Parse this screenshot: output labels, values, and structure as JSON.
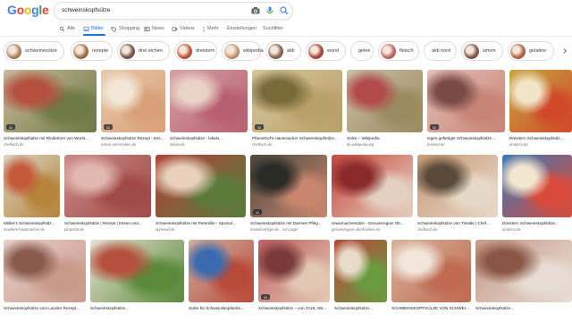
{
  "logo": {
    "letters": [
      "G",
      "o",
      "o",
      "g",
      "l",
      "e"
    ],
    "colors": [
      "#4285F4",
      "#EA4335",
      "#FBBC05",
      "#4285F4",
      "#34A853",
      "#EA4335"
    ]
  },
  "search": {
    "query": "schweinskopfsülze",
    "icons": [
      "camera-icon",
      "mic-icon",
      "search-icon"
    ]
  },
  "tabs": [
    {
      "label": "Alle",
      "icon": "search-icon"
    },
    {
      "label": "Bilder",
      "icon": "image-icon",
      "active": true
    },
    {
      "label": "Shopping",
      "icon": "tag-icon"
    },
    {
      "label": "News",
      "icon": "news-icon"
    },
    {
      "label": "Videos",
      "icon": "video-icon"
    },
    {
      "label": "Mehr",
      "icon": "more-icon"
    },
    {
      "label": "Einstellungen"
    },
    {
      "label": "Suchfilter"
    }
  ],
  "chips": [
    {
      "label": "schweinesülze",
      "color": "#b98a6a"
    },
    {
      "label": "rezepte",
      "color": "#a9744c"
    },
    {
      "label": "drei eichen",
      "color": "#7a5a4a"
    },
    {
      "label": "dreistern",
      "color": "#c65b3a"
    },
    {
      "label": "wikipedia",
      "color": "#c9a07a"
    },
    {
      "label": "aldi",
      "color": "#8e6a58"
    },
    {
      "label": "wurst",
      "color": "#b0473e"
    },
    {
      "label": "gelee",
      "color": ""
    },
    {
      "label": "fleisch",
      "color": "#c46e6e"
    },
    {
      "label": "aldi nord",
      "color": ""
    },
    {
      "label": "simon",
      "color": "#8a5d4c"
    },
    {
      "label": "gelatine",
      "color": "#b86a4a"
    }
  ],
  "results": [
    {
      "title": "Schweinskopfsülze mit Rindertorn von Wurst...",
      "source": "chefkoch.de",
      "colors": [
        "#c8b99c",
        "#6f7a45",
        "#b5503f"
      ],
      "badge": "11"
    },
    {
      "title": "Schweinskopfsülze Rezept - Essen und...",
      "source": "essen-und-trinken.de",
      "colors": [
        "#e9c7a8",
        "#d9a07a",
        "#f2e6d6"
      ],
      "badge": "11"
    },
    {
      "title": "Schweinskopfsülze - lokalo...",
      "source": "lokalo.de",
      "colors": [
        "#d4a0a2",
        "#b86070",
        "#e9d2c8"
      ],
      "badge": ""
    },
    {
      "title": "Pfannehof's Hausmacher Schweinskopfsülze...",
      "source": "chefkoch.de",
      "colors": [
        "#d6c69c",
        "#b9a06a",
        "#7a6a3a"
      ],
      "badge": "11"
    },
    {
      "title": "Sülze – Wikipedia",
      "source": "de.wikipedia.org",
      "colors": [
        "#c9c0a6",
        "#9a8a60",
        "#b24a4a"
      ],
      "badge": ""
    },
    {
      "title": "eigen gefertigte Schweinskopfsülze ...",
      "source": "brucker.de",
      "colors": [
        "#e4c0b8",
        "#c88476",
        "#7a4a46"
      ],
      "badge": "11"
    },
    {
      "title": "Dreistern Schweinskopfsülz...",
      "source": "amazon.de",
      "colors": [
        "#c6a640",
        "#d04a2a",
        "#f1e5c8"
      ],
      "badge": ""
    },
    {
      "title": "Müller's Schweinskopfsülz...",
      "source": "muellers-hausmacher.de",
      "colors": [
        "#d9d4c6",
        "#b6843a",
        "#c45a3a"
      ],
      "badge": ""
    },
    {
      "title": "Schweinskopfsülze | Rezept | Essen und...",
      "source": "pinterest.de",
      "colors": [
        "#c98a86",
        "#a14a4a",
        "#e0b8ae"
      ],
      "badge": ""
    },
    {
      "title": "Schweinskopfsülze mit Petersilie - Spezial...",
      "source": "spreewd.de",
      "colors": [
        "#b0423a",
        "#5b7a3a",
        "#e8d0bc"
      ],
      "badge": ""
    },
    {
      "title": "Schweinskopfsülze mit Darmen Pfleg...",
      "source": "moselmetzger.de · Auf Lager",
      "colors": [
        "#4b4a40",
        "#c9866e",
        "#2a2a26"
      ],
      "badge": "11"
    },
    {
      "title": "Hausmachersülze - Genussregion Ob...",
      "source": "genussregion-oberfranken.de",
      "colors": [
        "#c8483e",
        "#e4d0c0",
        "#8a2a2a"
      ],
      "badge": ""
    },
    {
      "title": "Schweinskopfsülze von Timtaki | Chef...",
      "source": "chefkoch.de",
      "colors": [
        "#c89a78",
        "#e6d8c6",
        "#5a4a3a"
      ],
      "badge": ""
    },
    {
      "title": "Dreistern Schweinskopfsülze...",
      "source": "amazon.de",
      "colors": [
        "#3a7ab8",
        "#d94a3a",
        "#f2e6d0"
      ],
      "badge": ""
    },
    {
      "title": "Schweinskopfsülze vom Landes Rezept...",
      "source": "",
      "colors": [
        "#e8cfc8",
        "#c89a8a",
        "#8a5a4e"
      ],
      "badge": ""
    },
    {
      "title": "Schweinskopfsülze...",
      "source": "",
      "colors": [
        "#e7e0d2",
        "#5a8a3a",
        "#b6503e"
      ],
      "badge": ""
    },
    {
      "title": "Sülze für Schweinskopfsülze...",
      "source": "",
      "colors": [
        "#d0b0a0",
        "#b84a3a",
        "#3a6ab0"
      ],
      "badge": ""
    },
    {
      "title": "Schweinskopfsülze – von ZAHL Wir...",
      "source": "",
      "colors": [
        "#c06060",
        "#e2c8b4",
        "#7a3a3a"
      ],
      "badge": "11"
    },
    {
      "title": "Schweinskopfsülze...",
      "source": "",
      "colors": [
        "#b8483c",
        "#6a9a40",
        "#e8dcc8"
      ],
      "badge": ""
    },
    {
      "title": "SCHWEINSKOPFSÜLZE VON SCHWEINE...",
      "source": "",
      "colors": [
        "#d7b09a",
        "#c06a52",
        "#f0e6da"
      ],
      "badge": ""
    },
    {
      "title": "Schweinskopfsülze...",
      "source": "",
      "colors": [
        "#c69a88",
        "#e7ddd4",
        "#8a5646"
      ],
      "badge": ""
    }
  ]
}
